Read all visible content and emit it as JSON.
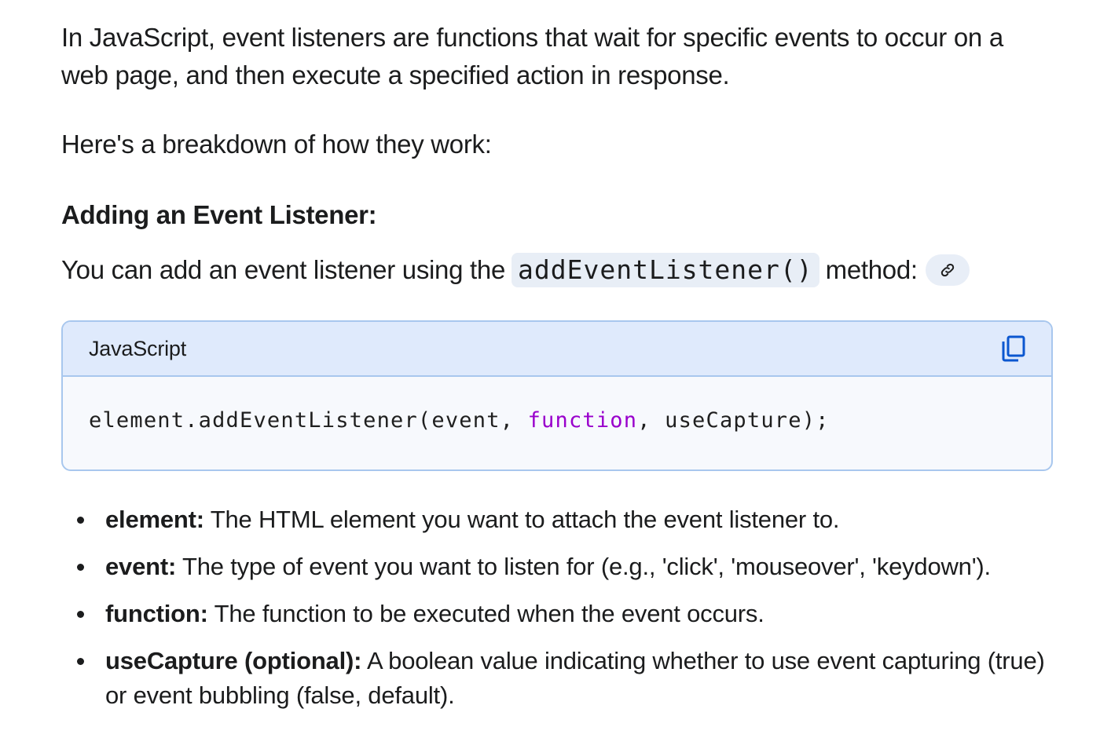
{
  "intro": "In JavaScript, event listeners are functions that wait for specific events to occur on a web page, and then execute a specified action in response.",
  "breakdown": "Here's a breakdown of how they work:",
  "heading": "Adding an Event Listener:",
  "method_line": {
    "before": "You can add an event listener using the",
    "code": "addEventListener()",
    "after": "method:",
    "link_icon": "link-icon"
  },
  "code_block": {
    "language": "JavaScript",
    "copy_icon": "copy-icon",
    "code_part1": "element.addEventListener(event, ",
    "code_keyword": "function",
    "code_part2": ", useCapture);",
    "keyword_color": "#9900cc"
  },
  "bullets": [
    {
      "term": "element:",
      "text": " The HTML element you want to attach the event listener to."
    },
    {
      "term": "event:",
      "text": " The type of event you want to listen for (e.g., 'click', 'mouseover', 'keydown')."
    },
    {
      "term": "function:",
      "text": " The function to be executed when the event occurs."
    },
    {
      "term": "useCapture (optional):",
      "text": " A boolean value indicating whether to use event capturing (true) or event bubbling (false, default)."
    }
  ]
}
